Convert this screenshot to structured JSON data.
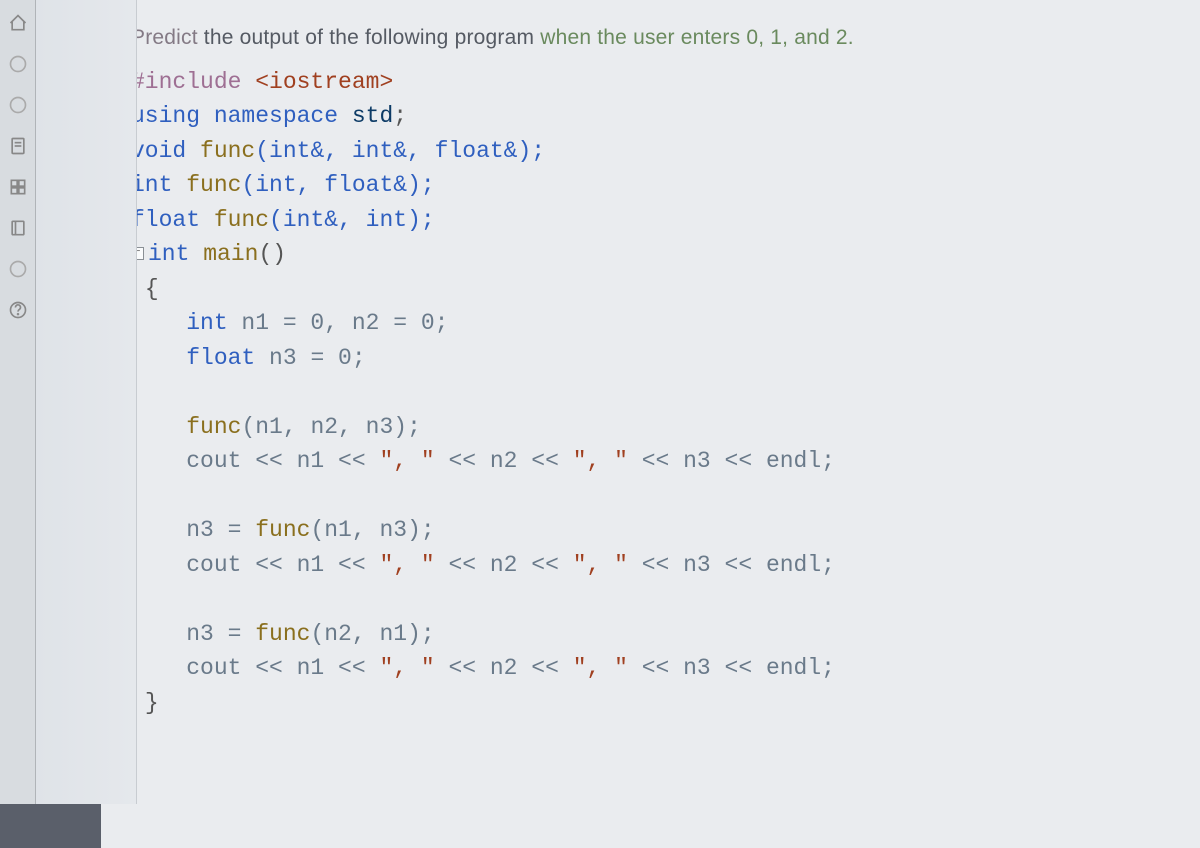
{
  "question": {
    "predict_word": "Predict",
    "mid": " the output of the following program ",
    "when_word": "when the user enters 0, 1, and 2."
  },
  "code": {
    "l01a": "#include",
    "l01b": " <iostream>",
    "l02a": "using namespace ",
    "l02b": "std",
    "l02c": ";",
    "l03a": "void ",
    "l03b": "func",
    "l03c": "(int&, int&, float&);",
    "l04a": "int ",
    "l04b": "func",
    "l04c": "(int, float&);",
    "l05a": "float ",
    "l05b": "func",
    "l05c": "(int&, int);",
    "l06a": "int ",
    "l06b": "main",
    "l06c": "()",
    "l07": "{",
    "l08a": "    int ",
    "l08b": "n1 = 0, n2 = 0;",
    "l09a": "    float ",
    "l09b": "n3 = 0;",
    "l11a": "    ",
    "l11b": "func",
    "l11c": "(n1, n2, n3);",
    "l12a": "    cout << n1 << ",
    "l12b": "\", \"",
    "l12c": " << n2 << ",
    "l12d": "\", \"",
    "l12e": " << n3 << endl;",
    "l14a": "    n3 = ",
    "l14b": "func",
    "l14c": "(n1, n3);",
    "l15a": "    cout << n1 << ",
    "l15b": "\", \"",
    "l15c": " << n2 << ",
    "l15d": "\", \"",
    "l15e": " << n3 << endl;",
    "l17a": "    n3 = ",
    "l17b": "func",
    "l17c": "(n2, n1);",
    "l18a": "    cout << n1 << ",
    "l18b": "\", \"",
    "l18c": " << n2 << ",
    "l18d": "\", \"",
    "l18e": " << n3 << endl;",
    "l19": "}"
  },
  "fold_symbol": "−"
}
